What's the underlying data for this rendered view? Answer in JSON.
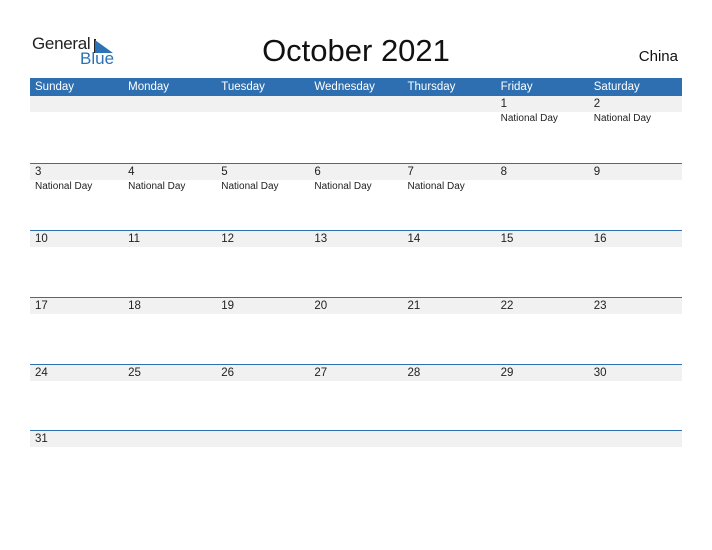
{
  "logo": {
    "part1": "General",
    "part2": "Blue"
  },
  "title": "October 2021",
  "country": "China",
  "weekdays": [
    "Sunday",
    "Monday",
    "Tuesday",
    "Wednesday",
    "Thursday",
    "Friday",
    "Saturday"
  ],
  "weeks": [
    [
      {
        "day": "",
        "event": ""
      },
      {
        "day": "",
        "event": ""
      },
      {
        "day": "",
        "event": ""
      },
      {
        "day": "",
        "event": ""
      },
      {
        "day": "",
        "event": ""
      },
      {
        "day": "1",
        "event": "National Day"
      },
      {
        "day": "2",
        "event": "National Day"
      }
    ],
    [
      {
        "day": "3",
        "event": "National Day"
      },
      {
        "day": "4",
        "event": "National Day"
      },
      {
        "day": "5",
        "event": "National Day"
      },
      {
        "day": "6",
        "event": "National Day"
      },
      {
        "day": "7",
        "event": "National Day"
      },
      {
        "day": "8",
        "event": ""
      },
      {
        "day": "9",
        "event": ""
      }
    ],
    [
      {
        "day": "10",
        "event": ""
      },
      {
        "day": "11",
        "event": ""
      },
      {
        "day": "12",
        "event": ""
      },
      {
        "day": "13",
        "event": ""
      },
      {
        "day": "14",
        "event": ""
      },
      {
        "day": "15",
        "event": ""
      },
      {
        "day": "16",
        "event": ""
      }
    ],
    [
      {
        "day": "17",
        "event": ""
      },
      {
        "day": "18",
        "event": ""
      },
      {
        "day": "19",
        "event": ""
      },
      {
        "day": "20",
        "event": ""
      },
      {
        "day": "21",
        "event": ""
      },
      {
        "day": "22",
        "event": ""
      },
      {
        "day": "23",
        "event": ""
      }
    ],
    [
      {
        "day": "24",
        "event": ""
      },
      {
        "day": "25",
        "event": ""
      },
      {
        "day": "26",
        "event": ""
      },
      {
        "day": "27",
        "event": ""
      },
      {
        "day": "28",
        "event": ""
      },
      {
        "day": "29",
        "event": ""
      },
      {
        "day": "30",
        "event": ""
      }
    ],
    [
      {
        "day": "31",
        "event": ""
      },
      {
        "day": "",
        "event": ""
      },
      {
        "day": "",
        "event": ""
      },
      {
        "day": "",
        "event": ""
      },
      {
        "day": "",
        "event": ""
      },
      {
        "day": "",
        "event": ""
      },
      {
        "day": "",
        "event": ""
      }
    ]
  ],
  "colors": {
    "accent": "#2e6fb1",
    "band": "#f1f1f1"
  }
}
